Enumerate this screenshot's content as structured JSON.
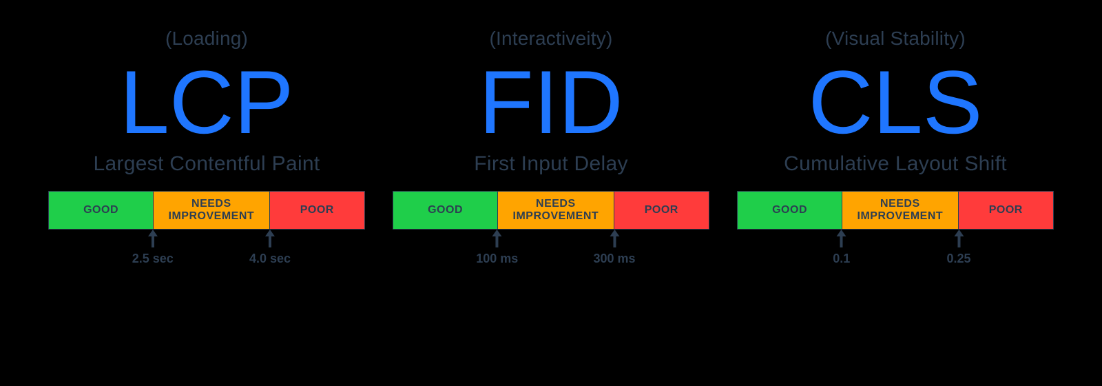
{
  "metrics": [
    {
      "category": "(Loading)",
      "acronym": "LCP",
      "fullname": "Largest Contentful Paint",
      "good": "GOOD",
      "needs_line1": "NEEDS",
      "needs_line2": "IMPROVEMENT",
      "poor": "POOR",
      "threshold1": "2.5 sec",
      "threshold2": "4.0 sec"
    },
    {
      "category": "(Interactiveity)",
      "acronym": "FID",
      "fullname": "First Input Delay",
      "good": "GOOD",
      "needs_line1": "NEEDS",
      "needs_line2": "IMPROVEMENT",
      "poor": "POOR",
      "threshold1": "100 ms",
      "threshold2": "300 ms"
    },
    {
      "category": "(Visual Stability)",
      "acronym": "CLS",
      "fullname": "Cumulative Layout Shift",
      "good": "GOOD",
      "needs_line1": "NEEDS",
      "needs_line2": "IMPROVEMENT",
      "poor": "POOR",
      "threshold1": "0.1",
      "threshold2": "0.25"
    }
  ]
}
